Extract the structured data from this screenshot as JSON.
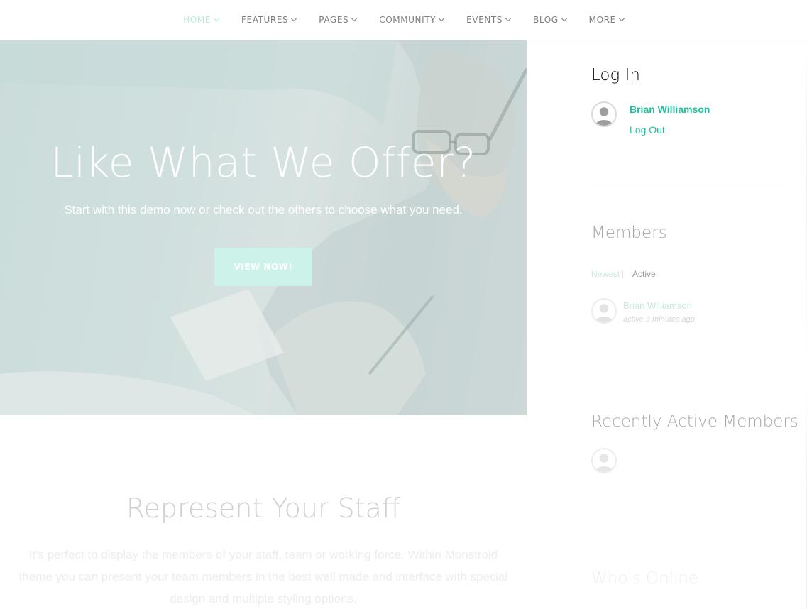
{
  "nav": {
    "items": [
      {
        "label": "HOME",
        "active": true
      },
      {
        "label": "FEATURES",
        "active": false
      },
      {
        "label": "PAGES",
        "active": false
      },
      {
        "label": "COMMUNITY",
        "active": false
      },
      {
        "label": "EVENTS",
        "active": false
      },
      {
        "label": "BLOG",
        "active": false
      },
      {
        "label": "MORE",
        "active": false
      }
    ]
  },
  "hero": {
    "title": "Like What We Offer?",
    "subtitle": "Start with this demo now or check out the others to choose what you need.",
    "button_label": "VIEW NOW!"
  },
  "staff": {
    "title": "Represent Your Staff",
    "text": "It's perfect to display the members of your staff, team or working force. Within Monstroid theme you can present your team members in the best well made and interface with special design and multiple styling options."
  },
  "sidebar": {
    "login": {
      "title": "Log In",
      "user_name": "Brian Williamson",
      "logout_label": "Log Out"
    },
    "members": {
      "title": "Members",
      "tab_newest": "Newest",
      "tab_separator": "|",
      "tab_active": "Active",
      "items": [
        {
          "name": "Brian Williamson",
          "status": "active 3 minutes ago"
        }
      ]
    },
    "recent": {
      "title": "Recently Active Members"
    },
    "online": {
      "title": "Who's Online"
    }
  },
  "colors": {
    "accent": "#1fc49f",
    "accent_light": "#cdf2ea",
    "nav_active": "#bde9dd"
  }
}
